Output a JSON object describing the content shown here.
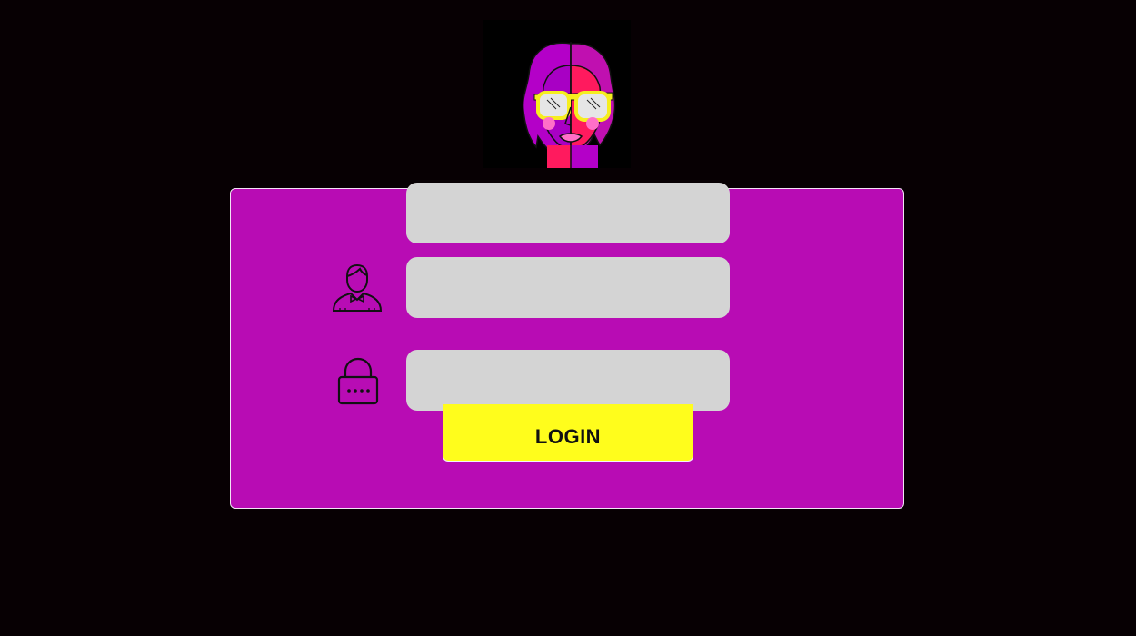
{
  "app": {
    "logo_icon": "split-face-sunglasses-avatar-icon"
  },
  "login_form": {
    "top_field": {
      "value": "",
      "placeholder": ""
    },
    "username": {
      "value": "",
      "placeholder": "",
      "icon": "user-icon"
    },
    "password": {
      "value": "",
      "placeholder": "",
      "icon": "lock-icon"
    },
    "login_label": "LOGIN"
  },
  "colors": {
    "background": "#070003",
    "panel": "#b80cb4",
    "panel_border": "#f1e4f5",
    "field": "#d4d4d4",
    "button": "#fffd1c",
    "button_text": "#111111",
    "logo_magenta": "#ff1a5e",
    "logo_purple": "#b400c8",
    "logo_glasses": "#f6ee1e"
  }
}
